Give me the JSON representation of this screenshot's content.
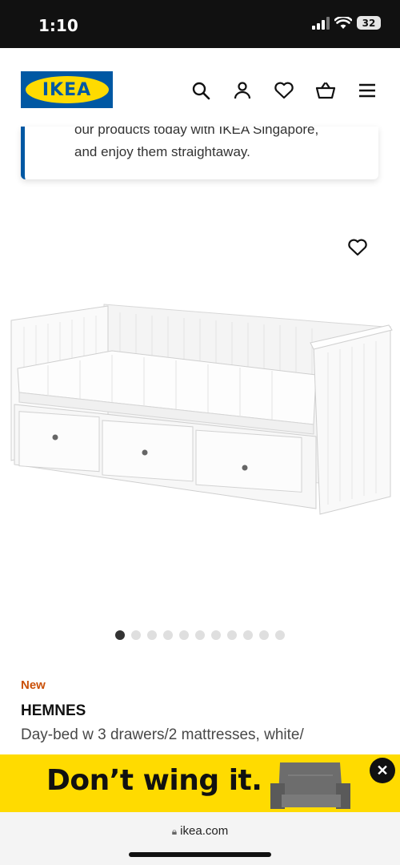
{
  "status_bar": {
    "time": "1:10",
    "battery": "32"
  },
  "header": {
    "logo_text": "IKEA"
  },
  "info_card": {
    "line1": "our products today with IKEA Singapore,",
    "line2": "and enjoy them straightaway."
  },
  "carousel": {
    "total": 11,
    "active": 1
  },
  "product": {
    "badge": "New",
    "name": "HEMNES",
    "description": "Day-bed w 3 drawers/2 mattresses, white/"
  },
  "banner": {
    "text": "Don’t wing it.",
    "close": "✕"
  },
  "browser": {
    "url": "ikea.com"
  },
  "colors": {
    "brand_blue": "#0058a3",
    "brand_yellow": "#ffdb00",
    "new_badge": "#ca5008"
  }
}
